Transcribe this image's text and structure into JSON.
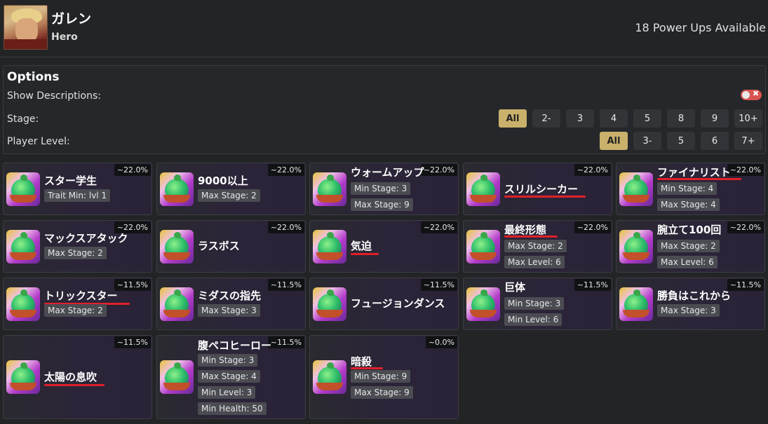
{
  "hero": {
    "name": "ガレン",
    "role": "Hero"
  },
  "powerups_available": "18 Power Ups Available",
  "options": {
    "title": "Options",
    "show_descriptions_label": "Show Descriptions:",
    "stage_label": "Stage:",
    "player_level_label": "Player Level:",
    "toggle_x": "✖",
    "stage_chips": [
      "All",
      "2-",
      "3",
      "4",
      "5",
      "8",
      "9",
      "10+"
    ],
    "level_chips": [
      "All",
      "3-",
      "5",
      "6",
      "7+"
    ]
  },
  "cards": [
    {
      "title": "スター学生",
      "pct": "~22.0%",
      "tags": [
        "Trait Min: lvl 1"
      ]
    },
    {
      "title": "9000以上",
      "pct": "~22.0%",
      "tags": [
        "Max Stage: 2"
      ]
    },
    {
      "title": "ウォームアップ",
      "pct": "~22.0%",
      "tags": [
        "Min Stage: 3",
        "Max Stage: 9"
      ]
    },
    {
      "title": "スリルシーカー",
      "pct": "~22.0%",
      "tags": []
    },
    {
      "title": "ファイナリスト",
      "pct": "~22.0%",
      "tags": [
        "Min Stage: 4",
        "Max Stage: 4"
      ]
    },
    {
      "title": "マックスアタック",
      "pct": "~22.0%",
      "tags": [
        "Max Stage: 2"
      ]
    },
    {
      "title": "ラスボス",
      "pct": "~22.0%",
      "tags": []
    },
    {
      "title": "気迫",
      "pct": "~22.0%",
      "tags": []
    },
    {
      "title": "最終形態",
      "pct": "~22.0%",
      "tags": [
        "Max Stage: 2",
        "Max Level: 6"
      ]
    },
    {
      "title": "腕立て100回",
      "pct": "~22.0%",
      "tags": [
        "Max Stage: 2",
        "Max Level: 6"
      ]
    },
    {
      "title": "トリックスター",
      "pct": "~11.5%",
      "tags": [
        "Max Stage: 2"
      ]
    },
    {
      "title": "ミダスの指先",
      "pct": "~11.5%",
      "tags": [
        "Max Stage: 3"
      ]
    },
    {
      "title": "フュージョンダンス",
      "pct": "~11.5%",
      "tags": []
    },
    {
      "title": "巨体",
      "pct": "~11.5%",
      "tags": [
        "Min Stage: 3",
        "Min Level: 6"
      ]
    },
    {
      "title": "勝負はこれから",
      "pct": "~11.5%",
      "tags": [
        "Max Stage: 3"
      ]
    },
    {
      "title": "太陽の息吹",
      "pct": "~11.5%",
      "tags": []
    },
    {
      "title": "腹ペコヒーロー",
      "pct": "~11.5%",
      "tags": [
        "Min Stage: 3",
        "Max Stage: 4",
        "Min Level: 3",
        "Min Health: 50"
      ]
    },
    {
      "title": "暗殺",
      "pct": "~0.0%",
      "tags": [
        "Min Stage: 9",
        "Max Stage: 9"
      ]
    }
  ]
}
